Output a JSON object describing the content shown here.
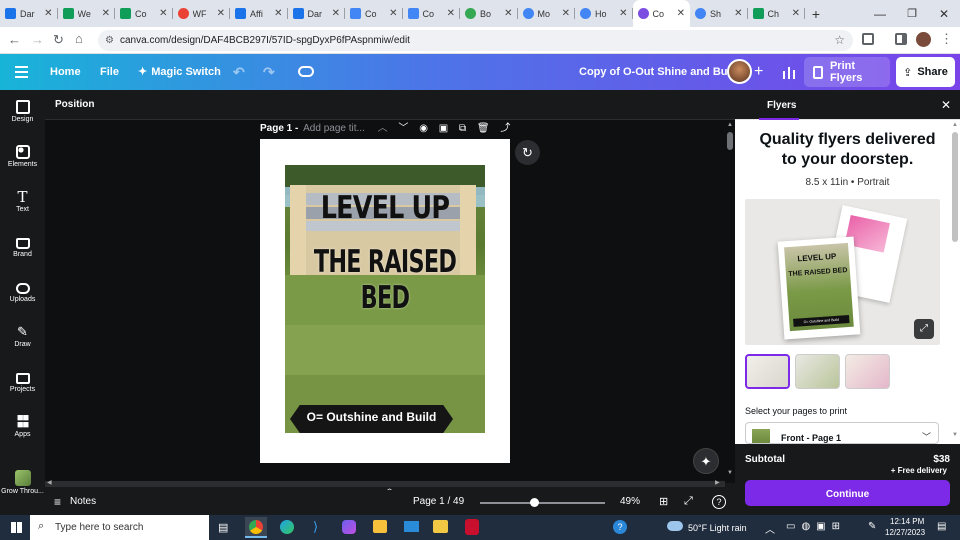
{
  "browser": {
    "tabs": [
      {
        "label": "Dar",
        "color": "#1a73e8"
      },
      {
        "label": "We",
        "color": "#0f9d58"
      },
      {
        "label": "Co",
        "color": "#0f9d58"
      },
      {
        "label": "WF",
        "color": "#ea4335"
      },
      {
        "label": "Affi",
        "color": "#1a73e8"
      },
      {
        "label": "Dar",
        "color": "#1a73e8"
      },
      {
        "label": "Co",
        "color": "#4285f4"
      },
      {
        "label": "Co",
        "color": "#4285f4"
      },
      {
        "label": "Bo",
        "color": "#34a853"
      },
      {
        "label": "Mo",
        "color": "#4285f4"
      },
      {
        "label": "Ho",
        "color": "#4285f4"
      },
      {
        "label": "Co",
        "color": "#7b4de0",
        "active": true
      },
      {
        "label": "Sh",
        "color": "#4285f4"
      },
      {
        "label": "Ch",
        "color": "#0f9d58"
      }
    ],
    "url": "canva.com/design/DAF4BCB297I/57ID-spgDyxP6fPAspnmiw/edit"
  },
  "topbar": {
    "home": "Home",
    "file": "File",
    "magic_switch": "Magic Switch",
    "doc_title": "Copy of O-Out Shine and Build",
    "print_flyers": "Print Flyers",
    "share": "Share"
  },
  "sidebar": {
    "items": [
      {
        "label": "Design",
        "icon": "design-icon"
      },
      {
        "label": "Elements",
        "icon": "elements-icon"
      },
      {
        "label": "Text",
        "icon": "text-icon"
      },
      {
        "label": "Brand",
        "icon": "brand-icon"
      },
      {
        "label": "Uploads",
        "icon": "uploads-icon"
      },
      {
        "label": "Draw",
        "icon": "draw-icon"
      },
      {
        "label": "Projects",
        "icon": "projects-icon"
      },
      {
        "label": "Apps",
        "icon": "apps-icon"
      },
      {
        "label": "Grow Throu...",
        "icon": "grow-app-icon"
      }
    ]
  },
  "subbar": {
    "position": "Position",
    "page_label": "Page 1 -",
    "page_title_placeholder": "Add page tit..."
  },
  "design": {
    "headline1": "LEVEL UP",
    "headline2": "THE RAISED BED",
    "banner": "O= Outshine and Build"
  },
  "bottombar": {
    "notes": "Notes",
    "page_counter": "Page 1 / 49",
    "zoom": "49%",
    "zoom_fraction": 0.49
  },
  "panel": {
    "title": "Flyers",
    "heading": "Quality flyers delivered to your doorstep.",
    "spec": "8.5 x 11in • Portrait",
    "preview_text1": "LEVEL UP",
    "preview_text2": "THE RAISED BED",
    "preview_banner": "O= Outshine and Build",
    "select_pages_label": "Select your pages to print",
    "select_value": "Front - Page 1",
    "subtotal_label": "Subtotal",
    "subtotal_value": "$38",
    "free_delivery": "+ Free delivery",
    "continue": "Continue"
  },
  "taskbar": {
    "search_placeholder": "Type here to search",
    "weather": "50°F Light rain",
    "time": "12:14 PM",
    "date": "12/27/2023"
  },
  "colors": {
    "accent": "#7d2ae8",
    "topbar_start": "#18b4d8",
    "topbar_end": "#7a43ea"
  }
}
